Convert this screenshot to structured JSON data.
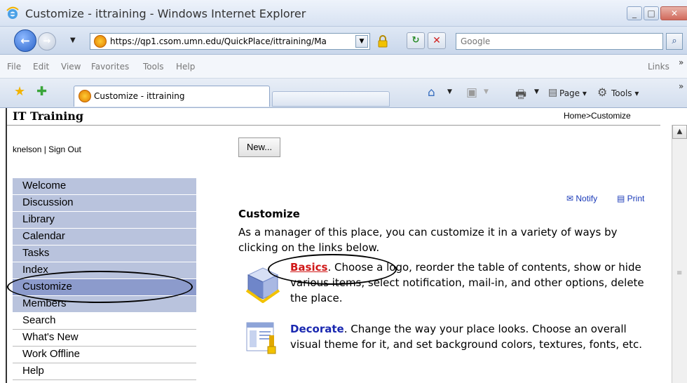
{
  "window": {
    "title": "Customize - ittraining - Windows Internet Explorer",
    "minimize": "_",
    "maximize": "□",
    "close": "✕"
  },
  "address_bar": {
    "url": "https://qp1.csom.umn.edu/QuickPlace/ittraining/Ma",
    "search_placeholder": "Google",
    "back_icon": "←",
    "forward_icon": "→",
    "dropdown": "▼",
    "refresh": "↻",
    "stop": "✕",
    "search_icon": "⌕"
  },
  "menu": {
    "items": [
      "File",
      "Edit",
      "View",
      "Favorites",
      "Tools",
      "Help"
    ],
    "links": "Links",
    "chevron": "»"
  },
  "tabs": {
    "active_label": "Customize - ittraining",
    "page_menu": "Page ▾",
    "tools_menu": "Tools ▾",
    "chevron": "»"
  },
  "page": {
    "site_title": "IT Training",
    "breadcrumb": "Home>Customize",
    "user": "knelson | Sign Out",
    "new_button": "New...",
    "toc_items": [
      "Welcome",
      "Discussion",
      "Library",
      "Calendar",
      "Tasks",
      "Index",
      "Customize",
      "Members"
    ],
    "selected_item": "Customize",
    "other_items": [
      "Search",
      "What's New",
      "Work Offline",
      "Help"
    ],
    "notify": "Notify",
    "print": "Print",
    "section_title": "Customize",
    "intro": "As a manager of this place, you can customize it in a variety of ways by clicking on the links below.",
    "basics_link": "Basics",
    "basics_desc": ". Choose a logo, reorder the table of contents, show or hide various items, select notification, mail-in, and other options, delete the place.",
    "decorate_link": "Decorate",
    "decorate_desc": ". Change the way your place looks. Choose an overall visual theme for it, and set background colors, textures, fonts, etc."
  },
  "colors": {
    "toc_bg": "#b9c3dd",
    "toc_selected": "#8c9bcc",
    "link_red": "#d01818",
    "link_blue": "#1a28b0"
  }
}
